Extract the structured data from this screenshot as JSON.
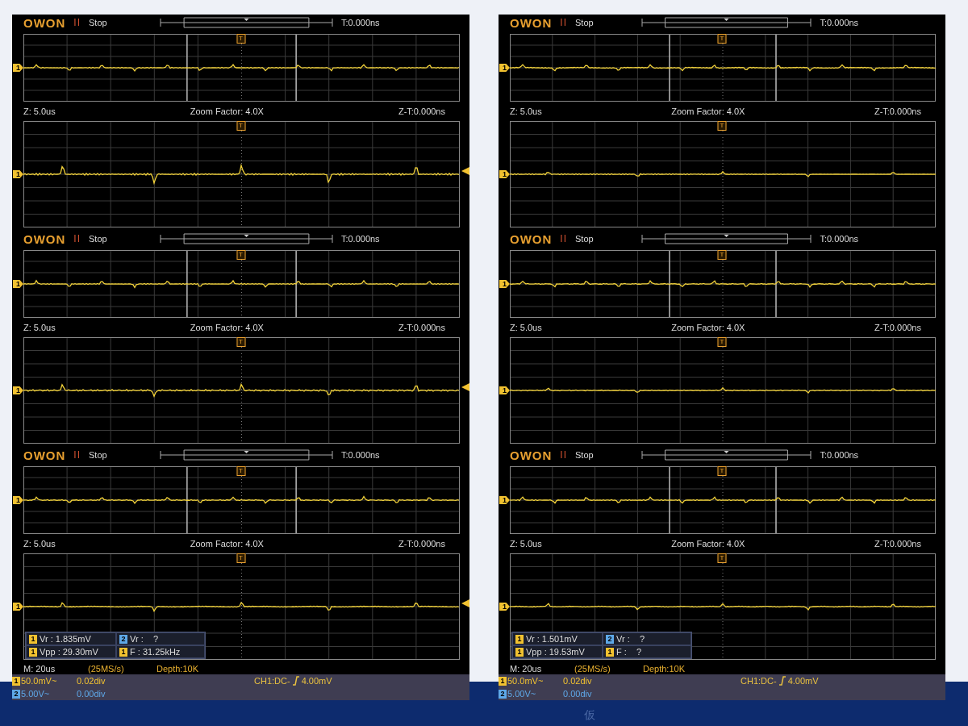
{
  "columns": [
    {
      "captures": [
        {
          "brand": "OWON",
          "run_glyph": "II",
          "run_state": "Stop",
          "trigger_time": "T:0.000ns",
          "trigger_marker": "T",
          "channel_marker": "1",
          "zoom_time": "Z: 5.0us",
          "zoom_factor": "Zoom Factor: 4.0X",
          "zoom_trigger_time": "Z-T:0.000ns",
          "lower_trigger_marker": "T",
          "lower_channel_marker": "1",
          "trigger_level_shown": true
        },
        {
          "brand": "OWON",
          "run_glyph": "II",
          "run_state": "Stop",
          "trigger_time": "T:0.000ns",
          "trigger_marker": "T",
          "channel_marker": "1",
          "zoom_time": "Z: 5.0us",
          "zoom_factor": "Zoom Factor: 4.0X",
          "zoom_trigger_time": "Z-T:0.000ns",
          "lower_trigger_marker": "T",
          "lower_channel_marker": "1",
          "trigger_level_shown": true
        },
        {
          "brand": "OWON",
          "run_glyph": "II",
          "run_state": "Stop",
          "trigger_time": "T:0.000ns",
          "trigger_marker": "T",
          "channel_marker": "1",
          "zoom_time": "Z: 5.0us",
          "zoom_factor": "Zoom Factor: 4.0X",
          "zoom_trigger_time": "Z-T:0.000ns",
          "lower_trigger_marker": "T",
          "lower_channel_marker": "1",
          "trigger_level_shown": true
        }
      ],
      "measurements": [
        {
          "channel": "1",
          "color": "#f2c230",
          "text": "Vr : 1.835mV"
        },
        {
          "channel": "2",
          "color": "#5ea8e8",
          "text": "Vr :    ?"
        },
        {
          "channel": "1",
          "color": "#f2c230",
          "text": "Vpp : 29.30mV"
        },
        {
          "channel": "1",
          "color": "#f2c230",
          "text": "F : 31.25kHz"
        }
      ],
      "acquisition": {
        "timebase": "M: 20us",
        "sample_rate": "(25MS/s)",
        "depth": "Depth:10K"
      },
      "channels": [
        {
          "channel": "1",
          "color": "#f2c230",
          "scale": "50.0mV~",
          "offset": "0.02div"
        },
        {
          "channel": "2",
          "color": "#5ea8e8",
          "scale": "5.00V~",
          "offset": "0.00div"
        }
      ],
      "trigger": {
        "source": "CH1:DC-",
        "level": "4.00mV"
      }
    },
    {
      "captures": [
        {
          "brand": "OWON",
          "run_glyph": "II",
          "run_state": "Stop",
          "trigger_time": "T:0.000ns",
          "trigger_marker": "T",
          "channel_marker": "1",
          "zoom_time": "Z: 5.0us",
          "zoom_factor": "Zoom Factor: 4.0X",
          "zoom_trigger_time": "Z-T:0.000ns",
          "lower_trigger_marker": "T",
          "lower_channel_marker": "1",
          "trigger_level_shown": false
        },
        {
          "brand": "OWON",
          "run_glyph": "II",
          "run_state": "Stop",
          "trigger_time": "T:0.000ns",
          "trigger_marker": "T",
          "channel_marker": "1",
          "zoom_time": "Z: 5.0us",
          "zoom_factor": "Zoom Factor: 4.0X",
          "zoom_trigger_time": "Z-T:0.000ns",
          "lower_trigger_marker": "T",
          "lower_channel_marker": "1",
          "trigger_level_shown": false
        },
        {
          "brand": "OWON",
          "run_glyph": "II",
          "run_state": "Stop",
          "trigger_time": "T:0.000ns",
          "trigger_marker": "T",
          "channel_marker": "1",
          "zoom_time": "Z: 5.0us",
          "zoom_factor": "Zoom Factor: 4.0X",
          "zoom_trigger_time": "Z-T:0.000ns",
          "lower_trigger_marker": "T",
          "lower_channel_marker": "1",
          "trigger_level_shown": false
        }
      ],
      "measurements": [
        {
          "channel": "1",
          "color": "#f2c230",
          "text": "Vr : 1.501mV"
        },
        {
          "channel": "2",
          "color": "#5ea8e8",
          "text": "Vr :    ?"
        },
        {
          "channel": "1",
          "color": "#f2c230",
          "text": "Vpp : 19.53mV"
        },
        {
          "channel": "1",
          "color": "#f2c230",
          "text": "F :    ?"
        }
      ],
      "acquisition": {
        "timebase": "M: 20us",
        "sample_rate": "(25MS/s)",
        "depth": "Depth:10K"
      },
      "channels": [
        {
          "channel": "1",
          "color": "#f2c230",
          "scale": "50.0mV~",
          "offset": "0.02div"
        },
        {
          "channel": "2",
          "color": "#5ea8e8",
          "scale": "5.00V~",
          "offset": "0.00div"
        }
      ],
      "trigger": {
        "source": "CH1:DC-",
        "level": "4.00mV"
      }
    }
  ],
  "footer": {
    "stamp": "仮"
  }
}
